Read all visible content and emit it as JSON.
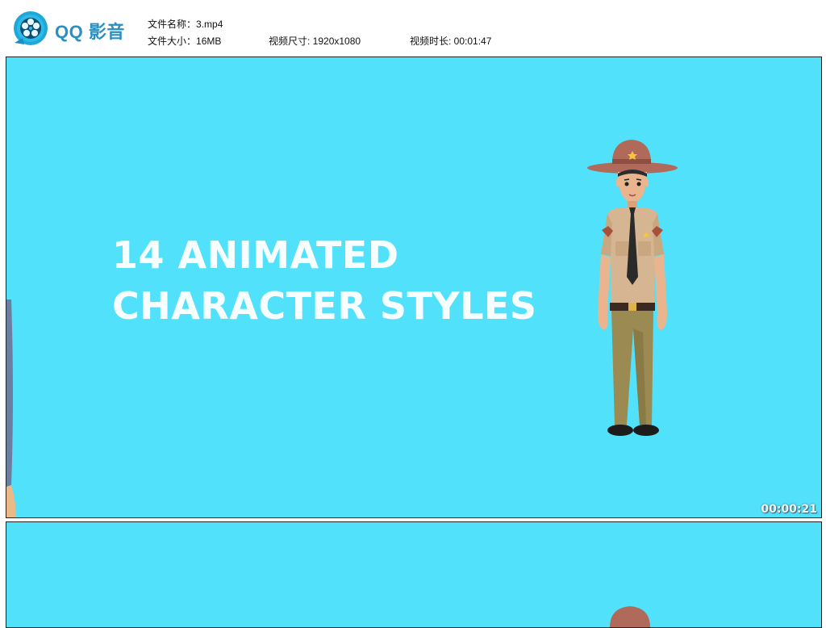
{
  "header": {
    "app_name": "QQ 影音",
    "file_name_label": "文件名称：",
    "file_name": "3.mp4",
    "file_size_label": "文件大小：",
    "file_size": "16MB",
    "dimensions_label": "视频尺寸: ",
    "dimensions": "1920x1080",
    "duration_label": "视频时长: ",
    "duration": "00:01:47"
  },
  "frames": [
    {
      "headline_line1": "14 ANIMATED",
      "headline_line2": "CHARACTER STYLES",
      "timestamp": "00:00:21",
      "background_color": "#52e1fb"
    },
    {
      "background_color": "#52e1fb"
    }
  ],
  "icons": [
    "qq-player-logo-icon"
  ]
}
